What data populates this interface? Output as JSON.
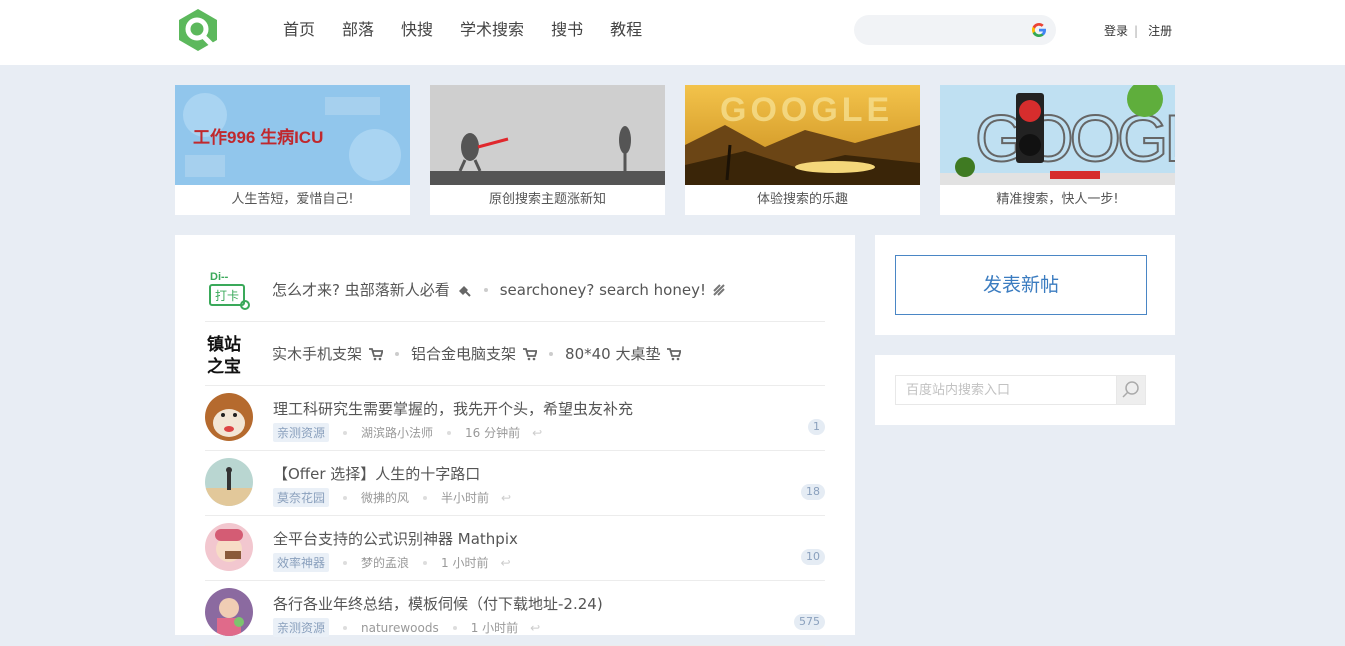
{
  "nav": [
    "首页",
    "部落",
    "快搜",
    "学术搜索",
    "搜书",
    "教程"
  ],
  "auth": {
    "login": "登录",
    "separator": "|",
    "register": "注册"
  },
  "banners": [
    {
      "overlay": "工作996  生病ICU",
      "caption": "人生苦短，爱惜自己!"
    },
    {
      "overlay": "",
      "caption": "原创搜索主题涨新知"
    },
    {
      "overlay": "GOOGLE",
      "caption": "体验搜索的乐趣"
    },
    {
      "overlay": "GOOGLE",
      "caption": "精准搜索，快人一步!"
    }
  ],
  "pinned": [
    {
      "icon_text": "Di-- 打卡",
      "items": [
        "怎么才来? 虫部落新人必看",
        "searchoney? search honey!"
      ]
    },
    {
      "icon_text": "镇站之宝",
      "items": [
        "实木手机支架",
        "铝合金电脑支架",
        "80*40 大桌垫"
      ]
    }
  ],
  "posts": [
    {
      "title": "理工科研究生需要掌握的，我先开个头，希望虫友补充",
      "tag": "亲测资源",
      "author": "湖滨路小法师",
      "time": "16 分钟前",
      "count": "1"
    },
    {
      "title": "【Offer 选择】人生的十字路口",
      "tag": "莫奈花园",
      "author": "微拂的风",
      "time": "半小时前",
      "count": "18"
    },
    {
      "title": "全平台支持的公式识别神器 Mathpix",
      "tag": "效率神器",
      "author": "梦的孟浪",
      "time": "1 小时前",
      "count": "10"
    },
    {
      "title": "各行各业年终总结，模板伺候（付下载地址-2.24)",
      "tag": "亲测资源",
      "author": "naturewoods",
      "time": "1 小时前",
      "count": "575"
    }
  ],
  "sidebar": {
    "new_post": "发表新帖",
    "search_placeholder": "百度站内搜索入口"
  },
  "colors": {
    "accent": "#4a86c5",
    "logo": "#5cb85c",
    "page_bg": "#e8edf4"
  }
}
